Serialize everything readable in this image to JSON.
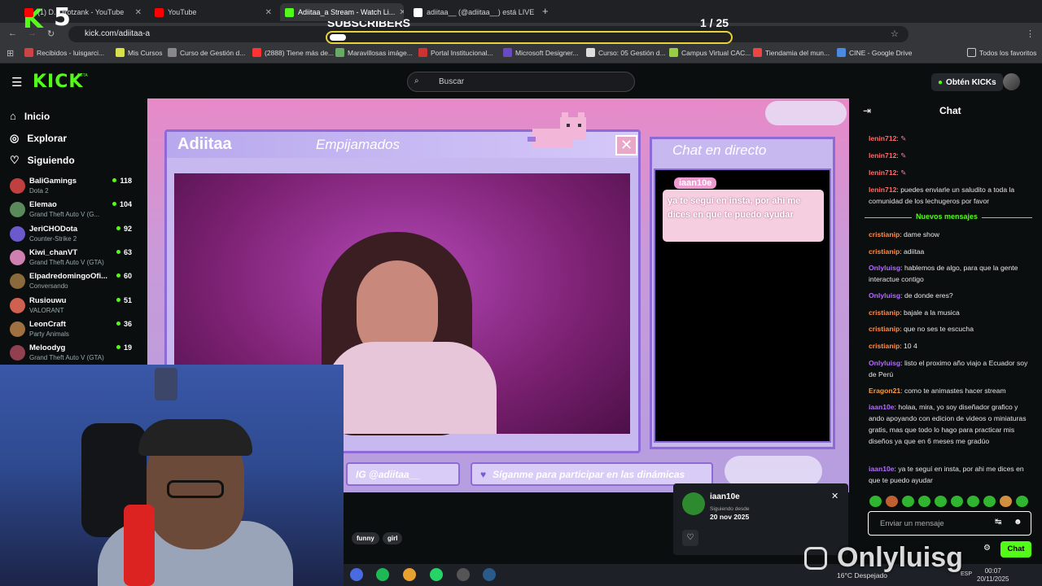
{
  "browser": {
    "tabs": [
      {
        "label": "(1) D... Rotzank - YouTube",
        "color": "#ff0000"
      },
      {
        "label": "YouTube",
        "color": "#ff0000"
      },
      {
        "label": "Adiitaa_a Stream - Watch Li...",
        "color": "#53fc18"
      },
      {
        "label": "adiitaa__ (@adiitaa__) está LIVE",
        "color": "#ffffff"
      }
    ],
    "url": "kick.com/adiitaa-a",
    "bookmarks": [
      "Recibidos - luisgarci...",
      "Mis Cursos",
      "Curso de Gestión d...",
      "(2888) Tiene más de...",
      "Maravillosas imáge...",
      "Portal Institucional...",
      "Microsoft Designer...",
      "Curso: 05 Gestión d...",
      "Campus Virtual CAC...",
      "Tiendamia del mun...",
      "CINE - Google Drive"
    ],
    "all_bookmarks": "Todos los favoritos"
  },
  "overlay": {
    "subs_title": "SUBSCRIBERS",
    "subs_count": "1 / 25",
    "subs_progress": 0.04,
    "badge_k": "K",
    "badge_num": "5"
  },
  "header": {
    "logo": "KICK",
    "logo_tag": "BETA",
    "search_placeholder": "Buscar",
    "kicks_button": "Obtén KICKs"
  },
  "sidebar": {
    "nav": [
      {
        "label": "Inicio",
        "icon": "home-icon"
      },
      {
        "label": "Explorar",
        "icon": "compass-icon"
      },
      {
        "label": "Siguiendo",
        "icon": "heart-icon"
      }
    ],
    "channels": [
      {
        "name": "BaliGamings",
        "game": "Dota 2",
        "viewers": "118",
        "color": "#c04040"
      },
      {
        "name": "Elemao",
        "game": "Grand Theft Auto V (G...",
        "viewers": "104",
        "color": "#5a8a5a"
      },
      {
        "name": "JeriCHODota",
        "game": "Counter-Strike 2",
        "viewers": "92",
        "color": "#6a5acd"
      },
      {
        "name": "Kiwi_chanVT",
        "game": "Grand Theft Auto V (GTA)",
        "viewers": "63",
        "color": "#d080b0"
      },
      {
        "name": "ElpadredomingoOfi...",
        "game": "Conversando",
        "viewers": "60",
        "color": "#8a6a3a"
      },
      {
        "name": "Rusiouwu",
        "game": "VALORANT",
        "viewers": "51",
        "color": "#d06050"
      },
      {
        "name": "LeonCraft",
        "game": "Party Animals",
        "viewers": "36",
        "color": "#a07040"
      },
      {
        "name": "Meloodyg",
        "game": "Grand Theft Auto V (GTA)",
        "viewers": "19",
        "color": "#904050"
      }
    ]
  },
  "stream": {
    "streamer": "Adiitaa",
    "title": "Empijamados",
    "chat_panel_title": "Chat en directo",
    "bubble_user": "iaan10e",
    "bubble_msg": "ya te seguí en insta, por ahi me dices en que te puedo ayudar",
    "pill_ig": "IG @adiitaa__",
    "pill_follow": "Síganme para participar en las dinámicas",
    "tags": [
      "funny",
      "girl"
    ]
  },
  "popup": {
    "user": "iaan10e",
    "since_label": "Siguiendo desde",
    "since_date": "20 nov 2025"
  },
  "chat": {
    "title": "Chat",
    "new_messages": "Nuevos mensajes",
    "messages_before": [
      {
        "user": "lenin712",
        "color": "#ff6a6a",
        "text": ""
      },
      {
        "user": "lenin712",
        "color": "#ff6a6a",
        "text": ""
      },
      {
        "user": "lenin712",
        "color": "#ff6a6a",
        "text": ""
      },
      {
        "user": "lenin712",
        "color": "#ff6a6a",
        "text": "puedes enviarle un saludito a toda la comunidad de los lechugeros por favor"
      }
    ],
    "messages_after": [
      {
        "user": "cristianip",
        "color": "#ff8c4a",
        "text": "dame show"
      },
      {
        "user": "cristianip",
        "color": "#ff8c4a",
        "text": "adiitaa"
      },
      {
        "user": "Onlyluisg",
        "color": "#b26bff",
        "text": "hablemos de algo, para que la gente interactue contigo"
      },
      {
        "user": "Onlyluisg",
        "color": "#b26bff",
        "text": "de donde eres?"
      },
      {
        "user": "cristianip",
        "color": "#ff8c4a",
        "text": "bajale a la musica"
      },
      {
        "user": "cristianip",
        "color": "#ff8c4a",
        "text": "que no ses te escucha"
      },
      {
        "user": "cristianip",
        "color": "#ff8c4a",
        "text": "10 4"
      },
      {
        "user": "Onlyluisg",
        "color": "#b26bff",
        "text": "listo el proximo año viajo a Ecuador soy de Perú"
      },
      {
        "user": "Eragon21",
        "color": "#ff9a3a",
        "text": "como te animastes hacer stream"
      },
      {
        "user": "iaan10e",
        "color": "#b26bff",
        "text": "holaa, mira, yo soy diseñador grafico y ando apoyando con edicion de videos o miniaturas gratis, mas que todo lo hago para practicar mis diseños ya que en 6 meses me gradúo"
      },
      {
        "user": "iaan10e",
        "color": "#b26bff",
        "text": "ya te seguí en insta, por ahi me dices en que te puedo ayudar"
      }
    ],
    "input_placeholder": "Enviar un mensaje",
    "send_button": "Chat"
  },
  "watermark": "Onlyluisg",
  "taskbar": {
    "weather": "16°C  Despejado",
    "time": "00:07",
    "date": "20/11/2025",
    "lang": "ESP"
  }
}
